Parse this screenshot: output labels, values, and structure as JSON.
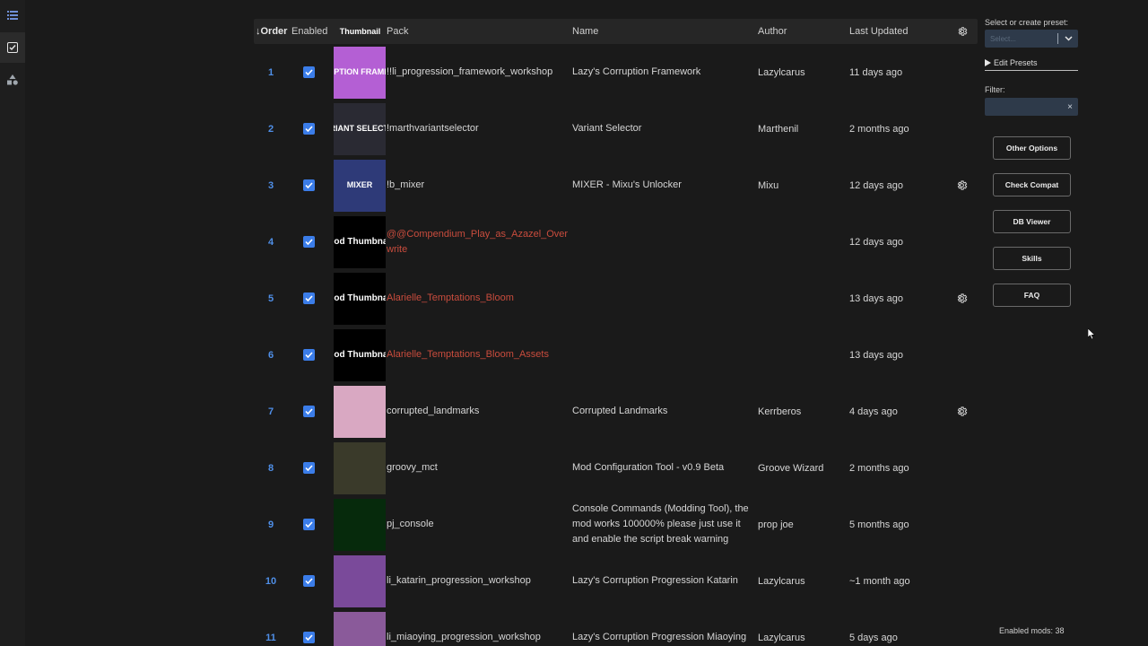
{
  "rail": {
    "icons": [
      "list-icon",
      "checklist-icon",
      "shapes-icon"
    ]
  },
  "table": {
    "headers": {
      "order": "Order",
      "enabled": "Enabled",
      "thumbnail": "Thumbnail",
      "pack": "Pack",
      "name": "Name",
      "author": "Author",
      "last_updated": "Last Updated"
    },
    "rows": [
      {
        "order": "1",
        "pack": "!!li_progression_framework_workshop",
        "name": "Lazy's Corruption Framework",
        "author": "Lazylcarus",
        "updated": "11 days ago",
        "thumb_text": "CORRUPTION FRAMEWORK",
        "thumb_bg": "#b45fd4"
      },
      {
        "order": "2",
        "pack": "!marthvariantselector",
        "name": "Variant Selector",
        "author": "Marthenil",
        "updated": "2 months ago",
        "thumb_text": "VARIANT SELECTOR",
        "thumb_bg": "#2a2a33"
      },
      {
        "order": "3",
        "pack": "!b_mixer",
        "name": "MIXER - Mixu's Unlocker",
        "author": "Mixu",
        "updated": "12 days ago",
        "thumb_text": "MIXER",
        "thumb_bg": "#2e3a78"
      },
      {
        "order": "4",
        "pack": "@@Compendium_Play_as_Azazel_Overwrite",
        "name": "",
        "author": "",
        "updated": "12 days ago",
        "thumb_text": "Mod Thumbnail",
        "thumb_bg": "#000000"
      },
      {
        "order": "5",
        "pack": "Alarielle_Temptations_Bloom",
        "name": "",
        "author": "",
        "updated": "13 days ago",
        "thumb_text": "Mod Thumbnail",
        "thumb_bg": "#000000"
      },
      {
        "order": "6",
        "pack": "Alarielle_Temptations_Bloom_Assets",
        "name": "",
        "author": "",
        "updated": "13 days ago",
        "thumb_text": "Mod Thumbnail",
        "thumb_bg": "#000000"
      },
      {
        "order": "7",
        "pack": "corrupted_landmarks",
        "name": "Corrupted Landmarks",
        "author": "Kerrberos",
        "updated": "4 days ago",
        "thumb_text": "",
        "thumb_bg": "#d9a8c2"
      },
      {
        "order": "8",
        "pack": "groovy_mct",
        "name": "Mod Configuration Tool - v0.9 Beta",
        "author": "Groove Wizard",
        "updated": "2 months ago",
        "thumb_text": "",
        "thumb_bg": "#3a3a2a"
      },
      {
        "order": "9",
        "pack": "pj_console",
        "name": "Console Commands (Modding Tool), the mod works 100000% please just use it and enable the script break warning",
        "author": "prop joe",
        "updated": "5 months ago",
        "thumb_text": "",
        "thumb_bg": "#062a0c"
      },
      {
        "order": "10",
        "pack": "li_katarin_progression_workshop",
        "name": "Lazy's Corruption Progression Katarin",
        "author": "Lazylcarus",
        "updated": "~1 month ago",
        "thumb_text": "",
        "thumb_bg": "#7a4a9a"
      },
      {
        "order": "11",
        "pack": "li_miaoying_progression_workshop",
        "name": "Lazy's Corruption Progression Miaoying",
        "author": "Lazylcarus",
        "updated": "5 days ago",
        "thumb_text": "",
        "thumb_bg": "#8a5a9a"
      }
    ]
  },
  "side": {
    "preset_label": "Select or create preset:",
    "preset_placeholder": "Select...",
    "edit_presets": "Edit Presets",
    "filter_label": "Filter:",
    "clear": "×",
    "buttons": [
      "Other Options",
      "Check Compat",
      "DB Viewer",
      "Skills",
      "FAQ"
    ],
    "enabled_mods": "Enabled mods: 38"
  },
  "colors": {
    "accent": "#3b7de9",
    "order_number": "#4f8fe8",
    "missing_pack": "#c94c3d"
  }
}
